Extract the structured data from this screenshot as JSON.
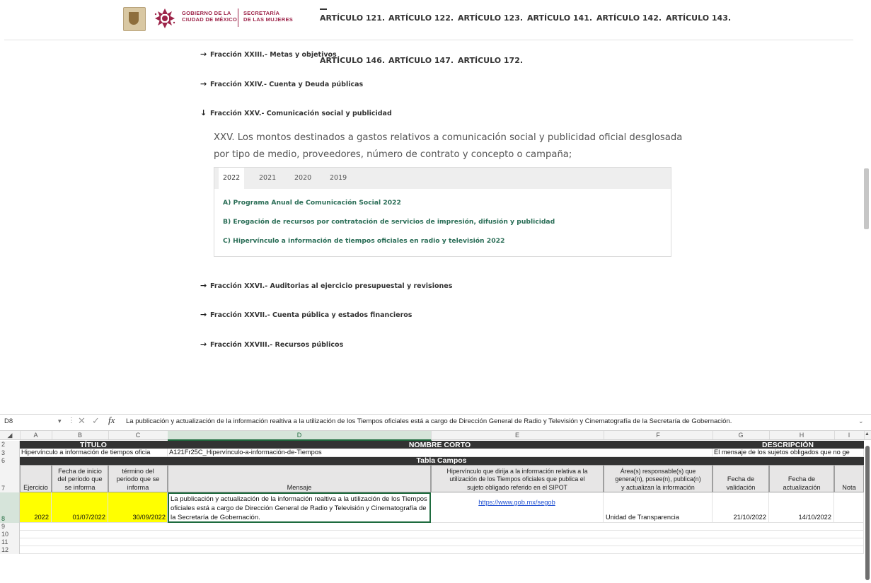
{
  "header": {
    "logo_left": "GOBIERNO DE LA\nCIUDAD DE MÉXICO",
    "logo_right": "SECRETARÍA\nDE LAS MUJERES",
    "nav_row1": [
      "ARTÍCULO 121.",
      "ARTÍCULO 122.",
      "ARTÍCULO 123.",
      "ARTÍCULO 141.",
      "ARTÍCULO 142.",
      "ARTÍCULO 143."
    ],
    "nav_row2": [
      "ARTÍCULO 146.",
      "ARTÍCULO 147.",
      "ARTÍCULO 172."
    ]
  },
  "content": {
    "fracciones_top": [
      {
        "label": "Fracción XXIII.- Metas y objetivos",
        "arrow": "→"
      },
      {
        "label": "Fracción XXIV.- Cuenta y Deuda públicas",
        "arrow": "→"
      },
      {
        "label": "Fracción XXV.- Comunicación social y publicidad",
        "arrow": "↓"
      }
    ],
    "description": "XXV. Los montos destinados a gastos relativos a comunicación social y publicidad oficial desglosada por tipo de medio, proveedores, número de contrato y concepto o campaña;",
    "tabs": [
      "2022",
      "2021",
      "2020",
      "2019"
    ],
    "active_tab": "2022",
    "links": [
      "A) Programa Anual de Comunicación Social 2022",
      "B) Erogación de recursos por contratación de servicios de impresión, difusión y publicidad",
      "C) Hipervínculo a información de tiempos oficiales en radio y televisión 2022"
    ],
    "fracciones_bottom": [
      {
        "label": "Fracción XXVI.- Auditorias al ejercicio presupuestal y revisiones",
        "arrow": "→"
      },
      {
        "label": "Fracción XXVII.- Cuenta pública y estados financieros",
        "arrow": "→"
      },
      {
        "label": "Fracción XXVIII.- Recursos públicos",
        "arrow": "→"
      }
    ]
  },
  "excel": {
    "name_box": "D8",
    "formula": "La publicación y actualización de la información realtiva a la utilización de los Tiempos oficiales está a cargo de Dirección General de Radio y Televisión y Cinematografía de la Secretaría de Gobernación.",
    "fx": "fx",
    "columns": [
      "A",
      "B",
      "C",
      "D",
      "E",
      "F",
      "G",
      "H",
      "I"
    ],
    "selected_column": "D",
    "row_numbers": [
      "2",
      "3",
      "6",
      "7",
      "8",
      "9",
      "10",
      "11",
      "12"
    ],
    "selected_row": "8",
    "row2": {
      "titulo": "TÍTULO",
      "nombre_corto": "NOMBRE CORTO",
      "descripcion": "DESCRIPCIÓN"
    },
    "row3": {
      "a": "Hipervínculo a información de tiempos oficia",
      "d": "A121Fr25C_Hipervínculo-a-información-de-Tiempos",
      "g": "El mensaje de los sujetos obligados que no ge"
    },
    "row6": {
      "tabla_campos": "Tabla Campos"
    },
    "headers": {
      "a": "Ejercicio",
      "b": "Fecha de inicio\ndel periodo que\nse informa",
      "c": "término del\nperiodo que se\ninforma",
      "d": "Mensaje",
      "e": "Hipervínculo que dirija a la información relativa a la\nutilización de los Tiempos oficiales que publica el\nsujeto obligado referido en el SIPOT",
      "f": "Área(s) responsable(s) que\ngenera(n), posee(n), publica(n)\ny actualizan la información",
      "g": "Fecha de\nvalidación",
      "h": "Fecha de\nactualización",
      "i": "Nota"
    },
    "row8": {
      "a": "2022",
      "b": "01/07/2022",
      "c": "30/09/2022",
      "d": "La publicación y actualización de la información realtiva a la utilización de los Tiempos oficiales está a cargo de Dirección General de Radio y Televisión y Cinematografía de la Secretaría de Gobernación.",
      "e": "https://www.gob.mx/segob",
      "f": "Unidad de Transparencia",
      "g": "21/10/2022",
      "h": "14/10/2022",
      "i": ""
    },
    "colors": {
      "header_dark": "#333333",
      "yellow": "#ffff00",
      "selection": "#1e6b3e",
      "link": "#1f4fd1"
    }
  }
}
